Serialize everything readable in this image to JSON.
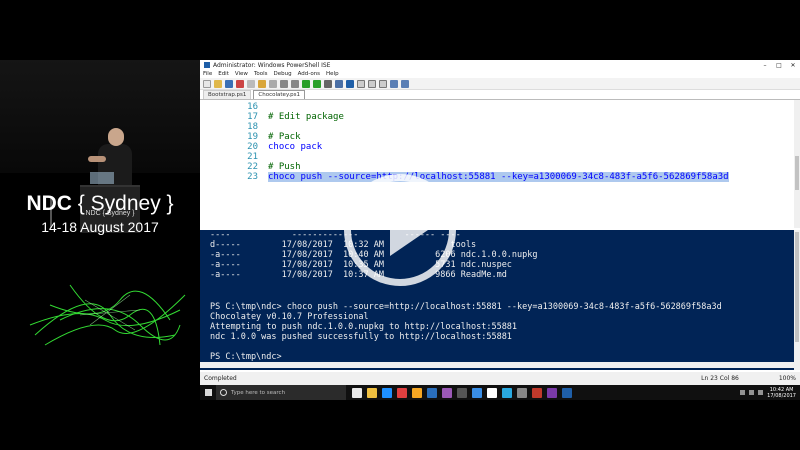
{
  "event": {
    "title_prefix": "NDC",
    "title_name": "{ Sydney }",
    "dates": "14-18 August 2017",
    "podium_label": "NDC { Sydney }"
  },
  "window": {
    "title": "Administrator: Windows PowerShell ISE",
    "controls": [
      "–",
      "□",
      "✕"
    ]
  },
  "menu": [
    "File",
    "Edit",
    "View",
    "Tools",
    "Debug",
    "Add-ons",
    "Help"
  ],
  "tabs": [
    {
      "label": "Bootstrap.ps1",
      "active": false
    },
    {
      "label": "Chocolatey.ps1",
      "active": true
    }
  ],
  "editor": {
    "lines": [
      {
        "n": "16",
        "text": "",
        "cls": ""
      },
      {
        "n": "17",
        "text": "# Edit package",
        "cls": "cm"
      },
      {
        "n": "18",
        "text": "",
        "cls": ""
      },
      {
        "n": "19",
        "text": "# Pack",
        "cls": "cm"
      },
      {
        "n": "20",
        "text": "choco pack",
        "cls": "kw"
      },
      {
        "n": "21",
        "text": "",
        "cls": ""
      },
      {
        "n": "22",
        "text": "# Push",
        "cls": "cm"
      },
      {
        "n": "23",
        "text": "choco push --source=http://localhost:55881 --key=a1300069-34c8-483f-a5f6-562869f58a3d",
        "cls": "kw hl"
      }
    ]
  },
  "console": {
    "lines": [
      "----            -------------         ------ ----",
      "d-----        17/08/2017  10:32 AM             tools",
      "-a----        17/08/2017  10:40 AM          6206 ndc.1.0.0.nupkg",
      "-a----        17/08/2017  10:35 AM          5731 ndc.nuspec",
      "-a----        17/08/2017  10:37 AM          9866 ReadMe.md",
      "",
      "",
      "PS C:\\tmp\\ndc> choco push --source=http://localhost:55881 --key=a1300069-34c8-483f-a5f6-562869f58a3d",
      "Chocolatey v0.10.7 Professional",
      "Attempting to push ndc.1.0.0.nupkg to http://localhost:55881",
      "ndc 1.0.0 was pushed successfully to http://localhost:55881",
      "",
      "PS C:\\tmp\\ndc>"
    ]
  },
  "status": {
    "text": "Completed",
    "position": "Ln 23  Col 86",
    "zoom": "100%"
  },
  "taskbar": {
    "search_placeholder": "Type here to search",
    "time": "10:42 AM",
    "date": "17/08/2017",
    "app_colors": [
      "#e8e8e8",
      "#f0c040",
      "#1e90ff",
      "#e04040",
      "#f5a623",
      "#2a6ebb",
      "#9b59b6",
      "#555555",
      "#3a8ee6",
      "#ffffff",
      "#2aa9e0",
      "#888888",
      "#c0392b",
      "#7a3aa8",
      "#1f5fa8"
    ]
  },
  "colors": {
    "console_bg": "#012456",
    "selection": "#aec9ee",
    "glow": "#3cff3c"
  }
}
